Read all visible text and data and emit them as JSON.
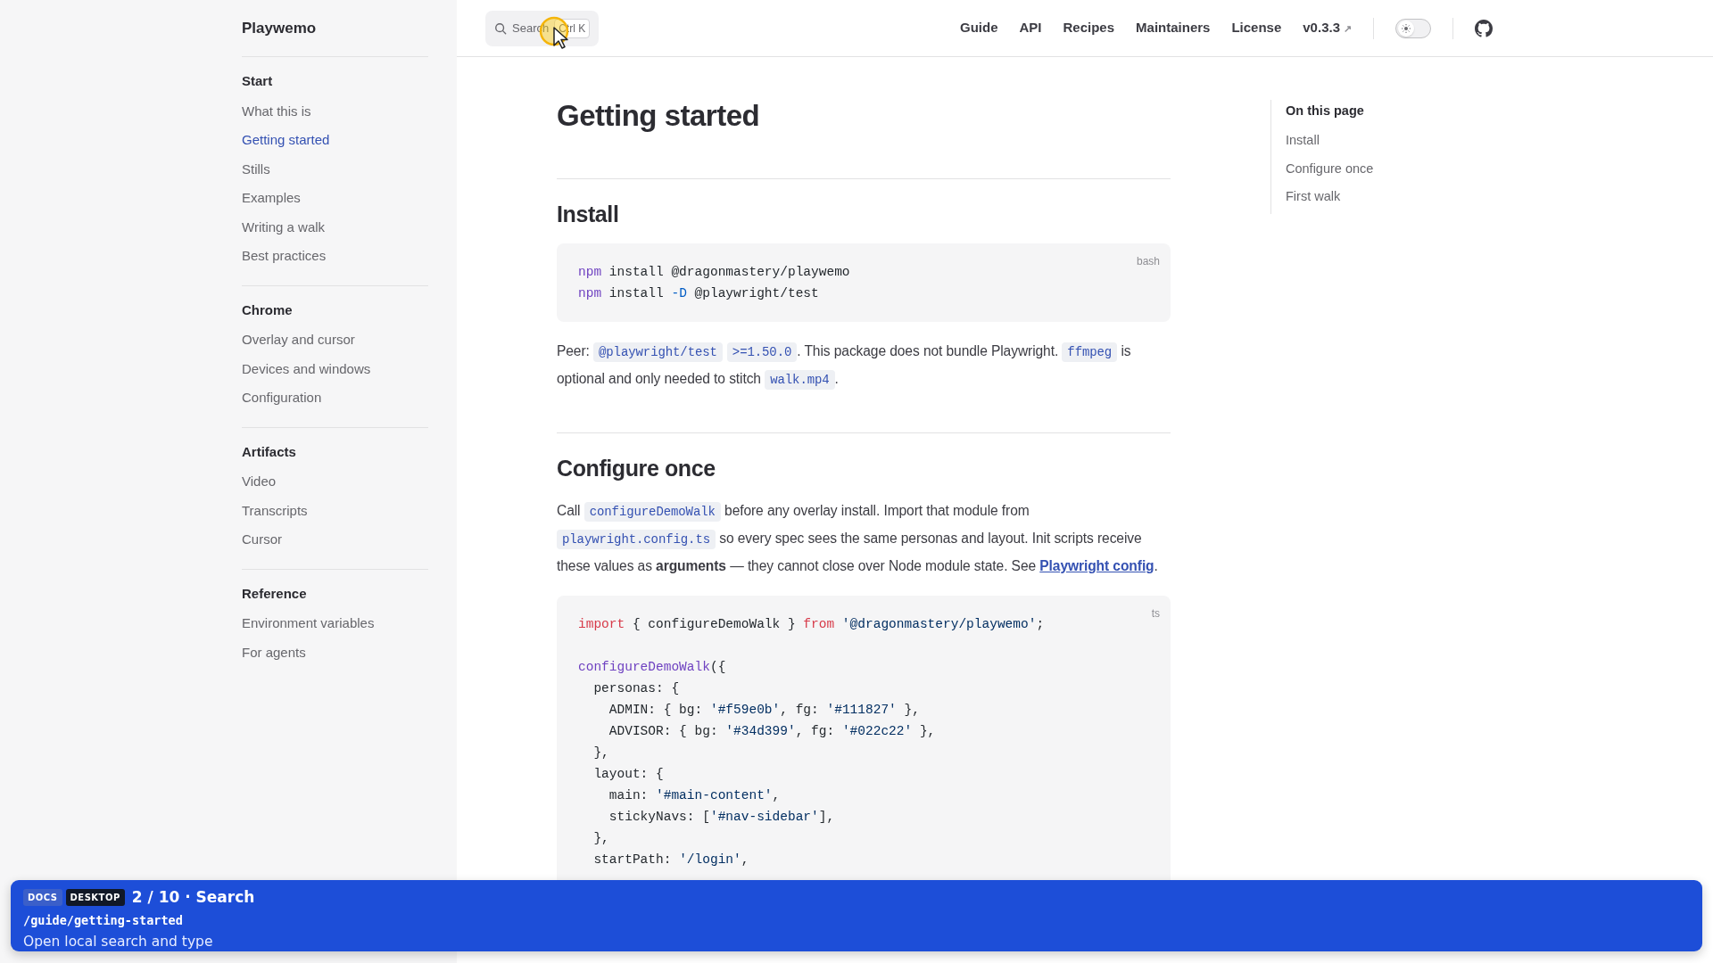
{
  "brand": "Playwemo",
  "search": {
    "label": "Search",
    "shortcut": "Ctrl K"
  },
  "nav_links": [
    {
      "label": "Guide"
    },
    {
      "label": "API"
    },
    {
      "label": "Recipes"
    },
    {
      "label": "Maintainers"
    },
    {
      "label": "License"
    },
    {
      "label": "v0.3.3",
      "external": "↗"
    }
  ],
  "theme_toggle": {
    "on": false
  },
  "sidebar": [
    {
      "title": "Start",
      "items": [
        {
          "label": "What this is",
          "selected": false
        },
        {
          "label": "Getting started",
          "selected": true
        },
        {
          "label": "Stills",
          "selected": false
        },
        {
          "label": "Examples",
          "selected": false
        },
        {
          "label": "Writing a walk",
          "selected": false
        },
        {
          "label": "Best practices",
          "selected": false
        }
      ]
    },
    {
      "title": "Chrome",
      "items": [
        {
          "label": "Overlay and cursor",
          "selected": false
        },
        {
          "label": "Devices and windows",
          "selected": false
        },
        {
          "label": "Configuration",
          "selected": false
        }
      ]
    },
    {
      "title": "Artifacts",
      "items": [
        {
          "label": "Video",
          "selected": false
        },
        {
          "label": "Transcripts",
          "selected": false
        },
        {
          "label": "Cursor",
          "selected": false
        }
      ]
    },
    {
      "title": "Reference",
      "items": [
        {
          "label": "Environment variables",
          "selected": false
        },
        {
          "label": "For agents",
          "selected": false
        }
      ]
    }
  ],
  "page_title": "Getting started",
  "sections": [
    {
      "heading": "Install",
      "blocks": [
        {
          "kind": "code",
          "lang": "bash",
          "lines": [
            {
              "tokens": [
                {
                  "kind": "cmd",
                  "text": "npm"
                },
                {
                  "kind": "plain",
                  "text": " install @dragonmastery/playwemo"
                }
              ]
            },
            {
              "tokens": [
                {
                  "kind": "cmd",
                  "text": "npm"
                },
                {
                  "kind": "plain",
                  "text": " install "
                },
                {
                  "kind": "flag",
                  "text": "-D"
                },
                {
                  "kind": "plain",
                  "text": " @playwright/test"
                }
              ]
            }
          ]
        },
        {
          "kind": "para",
          "parts": [
            {
              "kind": "text",
              "text": "Peer: "
            },
            {
              "kind": "code",
              "text": "@playwright/test"
            },
            {
              "kind": "code",
              "text": ">=1.50.0"
            },
            {
              "kind": "text",
              "text": ". This package does not bundle Playwright. "
            },
            {
              "kind": "code",
              "text": "ffmpeg"
            },
            {
              "kind": "text",
              "text": " is optional and only needed to stitch "
            },
            {
              "kind": "code",
              "text": "walk.mp4"
            },
            {
              "kind": "text",
              "text": "."
            }
          ]
        }
      ]
    },
    {
      "heading": "Configure once",
      "blocks": [
        {
          "kind": "para",
          "parts": [
            {
              "kind": "text",
              "text": "Call "
            },
            {
              "kind": "code",
              "text": "configureDemoWalk"
            },
            {
              "kind": "text",
              "text": " before any overlay install. Import that module from "
            },
            {
              "kind": "code",
              "text": "playwright.config.ts"
            },
            {
              "kind": "text",
              "text": " so every spec sees the same personas and layout. Init scripts receive these values as **arguments** — they cannot close over Node module state. See "
            },
            {
              "kind": "link",
              "text": "Playwright config"
            },
            {
              "kind": "text",
              "text": "."
            }
          ]
        },
        {
          "kind": "code",
          "lang": "ts",
          "lines": [
            {
              "tokens": [
                {
                  "kind": "keyword",
                  "text": "import"
                },
                {
                  "kind": "plain",
                  "text": " { configureDemoWalk } "
                },
                {
                  "kind": "keyword",
                  "text": "from"
                },
                {
                  "kind": "string",
                  "text": " '@dragonmastery/playwemo'"
                },
                {
                  "kind": "plain",
                  "text": ";"
                }
              ]
            },
            {
              "gap_before": true,
              "tokens": [
                {
                  "kind": "func",
                  "text": "configureDemoWalk"
                },
                {
                  "kind": "plain",
                  "text": "({"
                }
              ]
            },
            {
              "tokens": [
                {
                  "kind": "plain",
                  "text": "  personas: {"
                }
              ]
            },
            {
              "tokens": [
                {
                  "kind": "plain",
                  "text": "    ADMIN: { bg: "
                },
                {
                  "kind": "string",
                  "text": "'#f59e0b'"
                },
                {
                  "kind": "plain",
                  "text": ", fg: "
                },
                {
                  "kind": "string",
                  "text": "'#111827'"
                },
                {
                  "kind": "plain",
                  "text": " },"
                }
              ]
            },
            {
              "tokens": [
                {
                  "kind": "plain",
                  "text": "    ADVISOR: { bg: "
                },
                {
                  "kind": "string",
                  "text": "'#34d399'"
                },
                {
                  "kind": "plain",
                  "text": ", fg: "
                },
                {
                  "kind": "string",
                  "text": "'#022c22'"
                },
                {
                  "kind": "plain",
                  "text": " },"
                }
              ]
            },
            {
              "tokens": [
                {
                  "kind": "plain",
                  "text": "  },"
                }
              ]
            },
            {
              "tokens": [
                {
                  "kind": "plain",
                  "text": "  layout: {"
                }
              ]
            },
            {
              "tokens": [
                {
                  "kind": "plain",
                  "text": "    main: "
                },
                {
                  "kind": "string",
                  "text": "'#main-content'"
                },
                {
                  "kind": "plain",
                  "text": ","
                }
              ]
            },
            {
              "tokens": [
                {
                  "kind": "plain",
                  "text": "    stickyNavs: ["
                },
                {
                  "kind": "string",
                  "text": "'#nav-sidebar'"
                },
                {
                  "kind": "plain",
                  "text": "],"
                }
              ]
            },
            {
              "tokens": [
                {
                  "kind": "plain",
                  "text": "  },"
                }
              ]
            },
            {
              "tokens": [
                {
                  "kind": "plain",
                  "text": "  startPath: "
                },
                {
                  "kind": "string",
                  "text": "'/login'"
                },
                {
                  "kind": "plain",
                  "text": ","
                }
              ]
            }
          ]
        }
      ]
    }
  ],
  "toc": {
    "title": "On this page",
    "items": [
      {
        "label": "Install"
      },
      {
        "label": "Configure once"
      },
      {
        "label": "First walk"
      }
    ]
  },
  "banner": {
    "badges": [
      {
        "label": "DOCS",
        "kind": "muted"
      },
      {
        "label": "DESKTOP",
        "kind": "dark"
      }
    ],
    "step": "2 / 10 · Search",
    "path": "/guide/getting-started",
    "description": "Open local search and type"
  }
}
